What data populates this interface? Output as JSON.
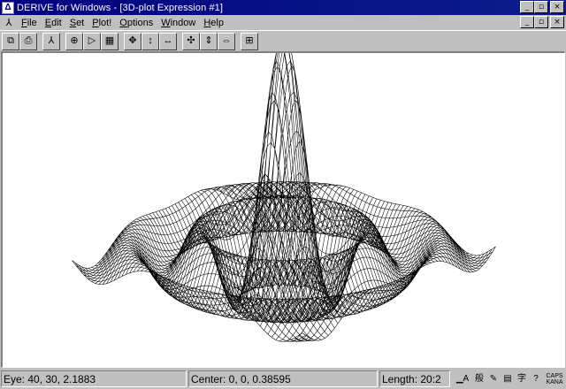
{
  "window": {
    "title": "DERIVE for Windows - [3D-plot Expression #1]",
    "controls": [
      "_",
      "▫",
      "×"
    ]
  },
  "doc_controls": [
    "_",
    "▫",
    "×"
  ],
  "menu": [
    {
      "key": "F",
      "rest": "ile"
    },
    {
      "key": "E",
      "rest": "dit"
    },
    {
      "key": "S",
      "rest": "et"
    },
    {
      "key": "P",
      "rest": "lot!"
    },
    {
      "key": "O",
      "rest": "ptions"
    },
    {
      "key": "W",
      "rest": "indow"
    },
    {
      "key": "H",
      "rest": "elp"
    }
  ],
  "toolbar": [
    {
      "name": "copy-icon",
      "glyph": "⧉"
    },
    {
      "name": "print-icon",
      "glyph": "⎙"
    },
    {
      "name": "axes-icon",
      "glyph": "⅄"
    },
    {
      "name": "crosshair-icon",
      "glyph": "⊕"
    },
    {
      "name": "play-icon",
      "glyph": "▷"
    },
    {
      "name": "grid-icon",
      "glyph": "▦"
    },
    {
      "name": "move-all-icon",
      "glyph": "✥"
    },
    {
      "name": "move-vertical-icon",
      "glyph": "↕"
    },
    {
      "name": "move-horizontal-icon",
      "glyph": "↔"
    },
    {
      "name": "zoom-all-icon",
      "glyph": "✣"
    },
    {
      "name": "zoom-vertical-icon",
      "glyph": "⇕"
    },
    {
      "name": "zoom-horizontal-icon",
      "glyph": "⇔"
    },
    {
      "name": "settings-grid-icon",
      "glyph": "⊞"
    }
  ],
  "status": {
    "eye": "Eye: 40, 30, 2.1883",
    "center": "Center: 0, 0, 0.38595",
    "length": "Length: 20:2"
  },
  "status_icons": [
    {
      "name": "ime-mode-icon",
      "glyph": "▁A"
    },
    {
      "name": "ime-kana-icon",
      "glyph": "般"
    },
    {
      "name": "ime-tool-icon",
      "glyph": "✎"
    },
    {
      "name": "ime-dictionary-icon",
      "glyph": "▤"
    },
    {
      "name": "ime-conversion-icon",
      "glyph": "字"
    },
    {
      "name": "ime-help-icon",
      "glyph": "?"
    }
  ],
  "ime_label": [
    "CAPS",
    "KANA"
  ]
}
